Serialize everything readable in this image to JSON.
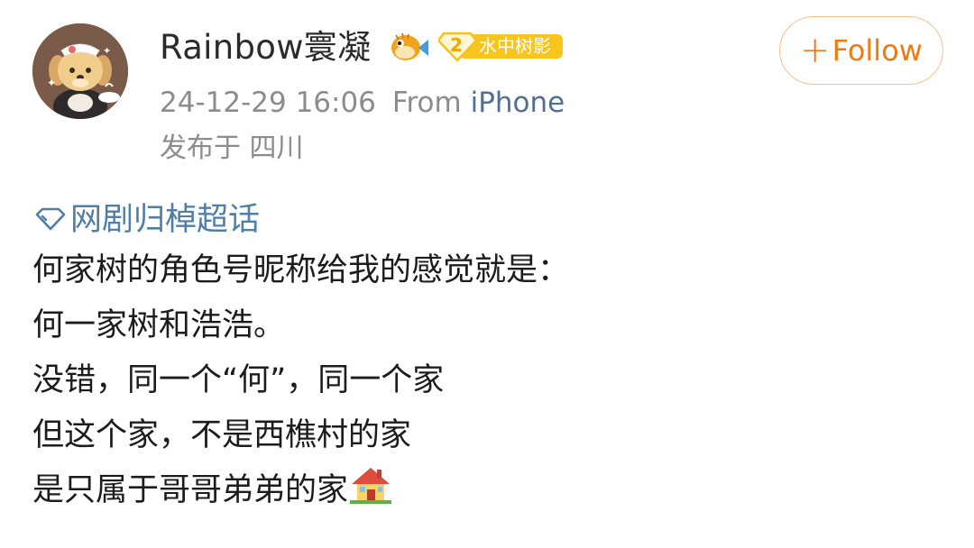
{
  "post": {
    "username": "Rainbow寰凝",
    "badge": {
      "level": "2",
      "label": "水中树影"
    },
    "timestamp": "24-12-29 16:06",
    "source_prefix": "From",
    "source_device": "iPhone",
    "location": "发布于 四川",
    "follow_label": "Follow",
    "topic": "网剧归棹超话",
    "lines": [
      "何家树的角色号昵称给我的感觉就是：",
      "何一家树和浩浩。",
      "没错，同一个“何”，同一个家",
      "但这个家，不是西樵村的家",
      "是只属于哥哥弟弟的家"
    ]
  },
  "icons": {
    "fish": "pufferfish-emoji-icon",
    "badge": "diamond-level-badge-icon",
    "topic": "super-topic-diamond-icon",
    "house": "house-emoji-icon"
  },
  "colors": {
    "follow": "#f07a12",
    "link": "#4f6f96",
    "topic": "#4f7ea8",
    "badge": "#f7c51e",
    "meta": "#8c8c8c"
  }
}
